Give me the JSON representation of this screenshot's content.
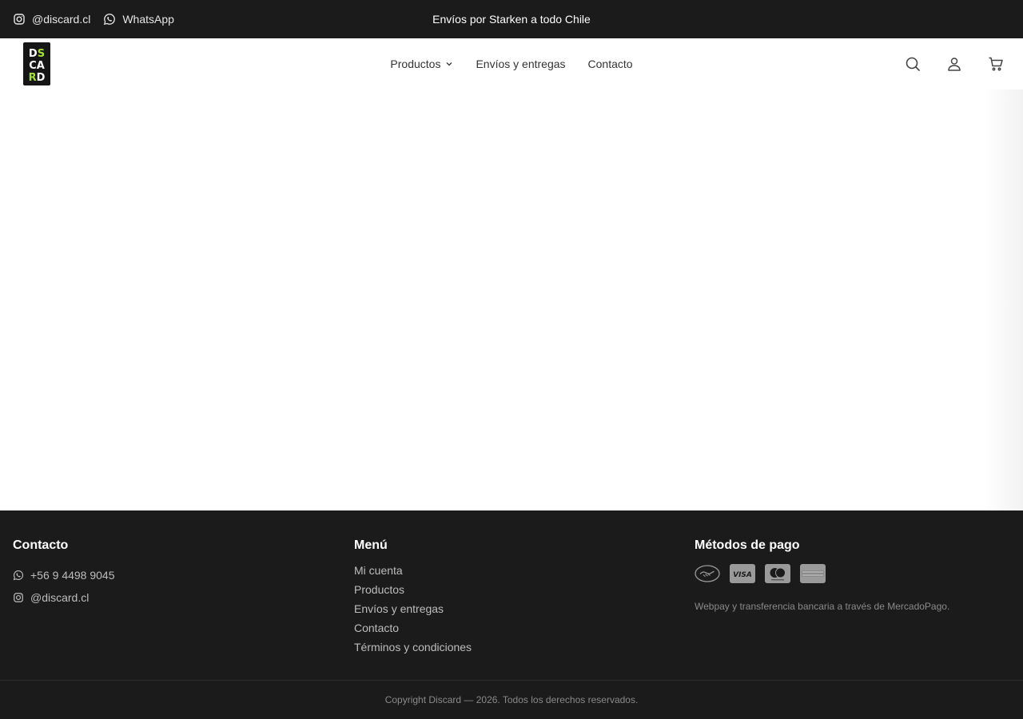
{
  "topbar": {
    "instagram_label": "@discard.cl",
    "whatsapp_label": "WhatsApp",
    "promo": "Envíos por Starken a todo Chile",
    "background": "#1b1b1b"
  },
  "header": {
    "logo": {
      "lines": [
        "DS",
        "CA",
        "RD"
      ],
      "accent": "#a4e03a"
    },
    "nav": [
      {
        "label": "Productos",
        "has_dropdown": true
      },
      {
        "label": "Envíos y entregas"
      },
      {
        "label": "Contacto"
      }
    ],
    "icons": [
      "search-icon",
      "account-icon",
      "cart-icon"
    ]
  },
  "footer": {
    "contact": {
      "title": "Contacto",
      "phone": "+56 9 4498 9045",
      "instagram": "@discard.cl"
    },
    "menu": {
      "title": "Menú",
      "items": [
        "Mi cuenta",
        "Productos",
        "Envíos y entregas",
        "Contacto",
        "Términos y condiciones"
      ]
    },
    "payment": {
      "title": "Métodos de pago",
      "methods": [
        "mercadopago-icon",
        "visa-icon",
        "mastercard-icon",
        "amex-icon"
      ],
      "visa_label": "VISA",
      "note": "Webpay y transferencia bancaria a través de MercadoPago."
    },
    "copyright": "Copyright Discard — 2026. Todos los derechos reservados."
  }
}
